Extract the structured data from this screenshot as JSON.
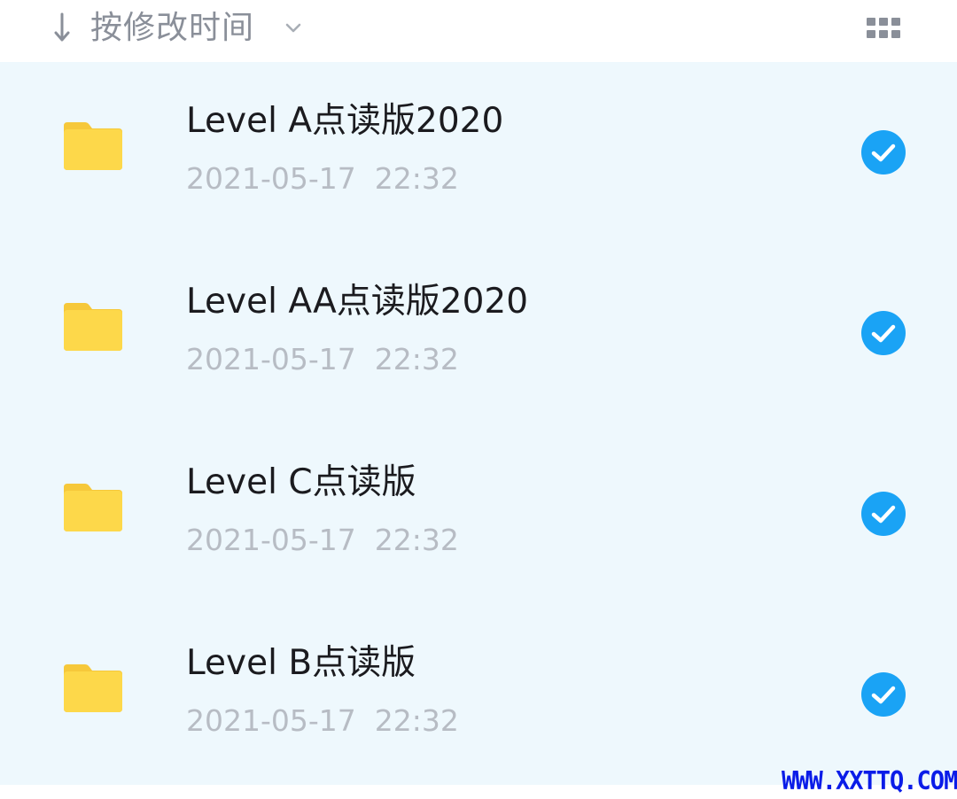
{
  "sort_bar": {
    "arrow_icon": "arrow-down-icon",
    "label": "按修改时间",
    "dropdown_icon": "chevron-down-icon",
    "view_toggle_icon": "grid-view-icon"
  },
  "colors": {
    "list_background": "#eef8fd",
    "folder": "#fdd84a",
    "check": "#1aa3f5",
    "date_text": "#b7bcc4",
    "sort_text": "#8a8f99",
    "watermark": "#0a1ce8"
  },
  "files": [
    {
      "name": "Level A点读版2020",
      "date": "2021-05-17  22:32",
      "selected": true,
      "icon": "folder-icon"
    },
    {
      "name": "Level AA点读版2020",
      "date": "2021-05-17  22:32",
      "selected": true,
      "icon": "folder-icon"
    },
    {
      "name": "Level C点读版",
      "date": "2021-05-17  22:32",
      "selected": true,
      "icon": "folder-icon"
    },
    {
      "name": "Level B点读版",
      "date": "2021-05-17  22:32",
      "selected": true,
      "icon": "folder-icon"
    }
  ],
  "watermark": "WWW.XXTTQ.COM"
}
